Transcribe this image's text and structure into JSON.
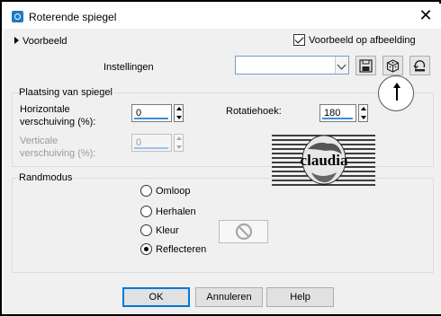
{
  "window": {
    "title": "Roterende spiegel",
    "close_glyph": "✕",
    "icon": "app-icon"
  },
  "preview": {
    "toggle_label": "Voorbeeld",
    "checkbox_label": "Voorbeeld op afbeelding",
    "checked": true
  },
  "settings": {
    "label": "Instellingen",
    "value": "",
    "buttons": [
      "save-icon",
      "randomize-icon",
      "reset-icon"
    ]
  },
  "placement": {
    "title": "Plaatsing van spiegel",
    "horizontal_label_1": "Horizontale",
    "horizontal_label_2": "verschuiving (%):",
    "horizontal_value": "0",
    "vertical_label_1": "Verticale",
    "vertical_label_2": "verschuiving (%):",
    "vertical_value": "0",
    "rotation_label": "Rotatiehoek:",
    "rotation_value": "180"
  },
  "edge_mode": {
    "title": "Randmodus",
    "options": [
      "Omloop",
      "Herhalen",
      "Kleur",
      "Reflecteren"
    ],
    "selected": "Reflecteren"
  },
  "watermark": {
    "text": "claudia"
  },
  "buttons": {
    "ok": "OK",
    "cancel": "Annuleren",
    "help": "Help"
  },
  "colors": {
    "accent": "#0078d7",
    "spin_underline": "#3c8fd8",
    "client_bg": "#f0f0f0"
  }
}
